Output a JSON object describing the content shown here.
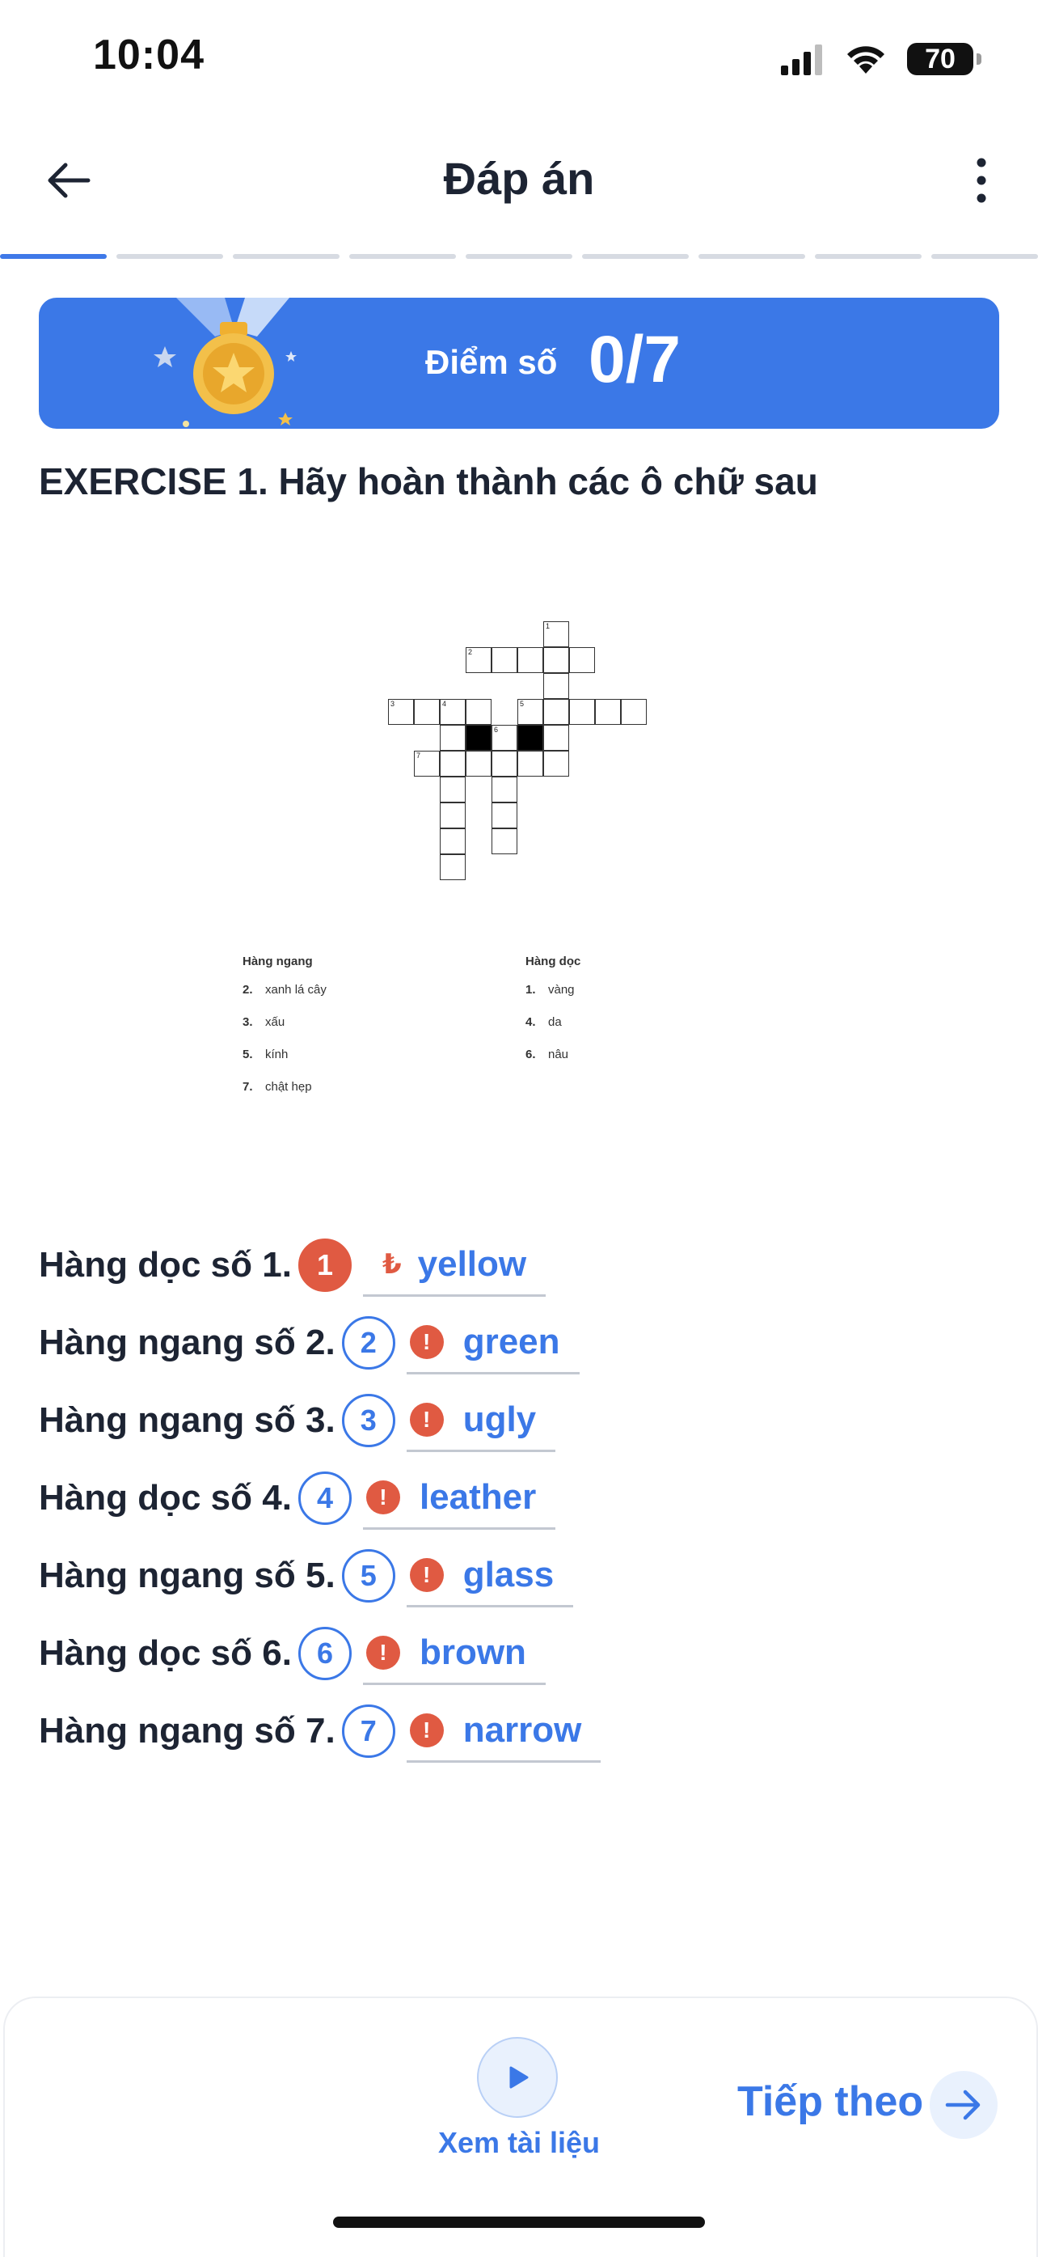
{
  "status": {
    "time": "10:04",
    "battery": "70"
  },
  "header": {
    "title": "Đáp án"
  },
  "progress": {
    "total_segments": 9,
    "active_index": 0
  },
  "score": {
    "label": "Điểm số",
    "value": "0/7"
  },
  "exercise": {
    "title": "EXERCISE 1. Hãy hoàn thành các ô chữ sau"
  },
  "clues": {
    "across_heading": "Hàng ngang",
    "across": [
      {
        "num": "2.",
        "text": "xanh lá cây"
      },
      {
        "num": "3.",
        "text": "xấu"
      },
      {
        "num": "5.",
        "text": "kính"
      },
      {
        "num": "7.",
        "text": "chật hẹp"
      }
    ],
    "down_heading": "Hàng dọc",
    "down": [
      {
        "num": "1.",
        "text": "vàng"
      },
      {
        "num": "4.",
        "text": "da"
      },
      {
        "num": "6.",
        "text": "nâu"
      }
    ]
  },
  "answers": [
    {
      "label": "Hàng dọc số 1.",
      "number": "1",
      "value": "yellow",
      "selected": true,
      "icon": "₺"
    },
    {
      "label": "Hàng ngang số 2.",
      "number": "2",
      "value": "green",
      "selected": false,
      "icon": "!"
    },
    {
      "label": "Hàng ngang số 3.",
      "number": "3",
      "value": "ugly",
      "selected": false,
      "icon": "!"
    },
    {
      "label": "Hàng dọc số 4.",
      "number": "4",
      "value": "leather",
      "selected": false,
      "icon": "!"
    },
    {
      "label": "Hàng ngang số 5.",
      "number": "5",
      "value": "glass",
      "selected": false,
      "icon": "!"
    },
    {
      "label": "Hàng dọc số 6.",
      "number": "6",
      "value": "brown",
      "selected": false,
      "icon": "!"
    },
    {
      "label": "Hàng ngang số 7.",
      "number": "7",
      "value": "narrow",
      "selected": false,
      "icon": "!"
    }
  ],
  "footer": {
    "video_label": "Xem tài liệu",
    "next_label": "Tiếp theo"
  },
  "colors": {
    "accent": "#3b78e7",
    "error": "#e05a42",
    "text": "#1d2433"
  }
}
